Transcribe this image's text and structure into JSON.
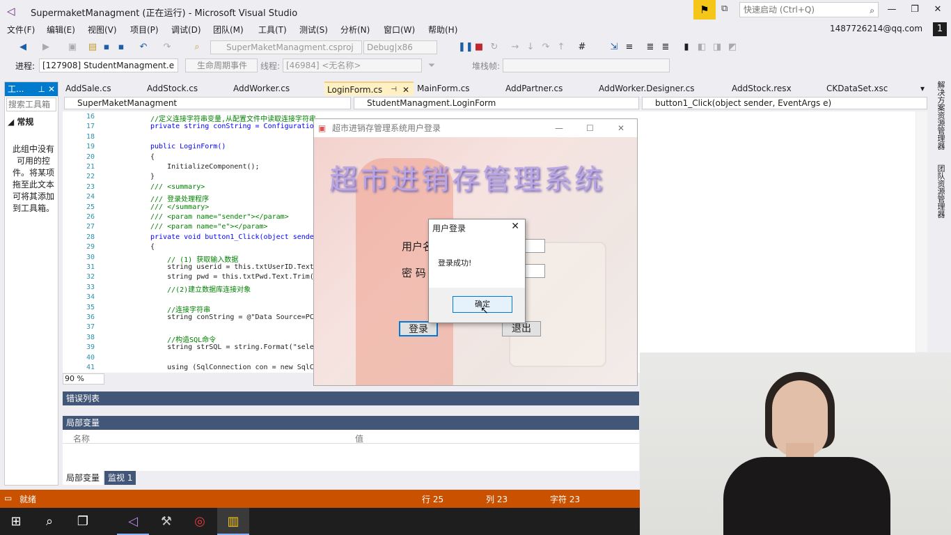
{
  "window": {
    "title": "SupermaketManagment (正在运行) - Microsoft Visual Studio",
    "quick_launch_placeholder": "快速启动 (Ctrl+Q)",
    "account": "1487726214@qq.com",
    "account_badge": "1"
  },
  "menu": [
    "文件(F)",
    "编辑(E)",
    "视图(V)",
    "项目(P)",
    "调试(D)",
    "团队(M)",
    "工具(T)",
    "测试(S)",
    "分析(N)",
    "窗口(W)",
    "帮助(H)"
  ],
  "toolbar": {
    "project_dropdown": "SuperMaketManagment.csproj",
    "config_dropdown": "Debug|x86",
    "process_label": "进程:",
    "process_value": "[127908] StudentManagment.e",
    "lifecycle_label": "生命周期事件",
    "thread_label": "线程:",
    "thread_value": "[46984] <无名称>",
    "stackframe_label": "堆栈帧:"
  },
  "toolbox": {
    "title": "工...",
    "search_placeholder": "搜索工具箱",
    "group": "常规",
    "empty_text": "此组中没有可用的控件。将某项拖至此文本可将其添加到工具箱。"
  },
  "tabs": [
    "AddSale.cs",
    "AddStock.cs",
    "AddWorker.cs",
    "LoginForm.cs",
    "MainForm.cs",
    "AddPartner.cs",
    "AddWorker.Designer.cs",
    "AddStock.resx",
    "CKDataSet.xsc"
  ],
  "active_tab": "LoginForm.cs",
  "navbar": {
    "project": "SuperMaketManagment",
    "class": "StudentManagment.LoginForm",
    "member": "button1_Click(object sender, EventArgs e)"
  },
  "code_lines": [
    {
      "n": "16",
      "t": "//定义连接字符串变量,从配置文件中读取连接字符串",
      "c": "comment"
    },
    {
      "n": "17",
      "t": "private string conString = Configuration",
      "c": "kw"
    },
    {
      "n": "18",
      "t": "",
      "c": ""
    },
    {
      "n": "19",
      "t": "public LoginForm()",
      "c": "kw"
    },
    {
      "n": "20",
      "t": "{",
      "c": ""
    },
    {
      "n": "21",
      "t": "    InitializeComponent();",
      "c": ""
    },
    {
      "n": "22",
      "t": "}",
      "c": ""
    },
    {
      "n": "23",
      "t": "/// <summary>",
      "c": "comment"
    },
    {
      "n": "24",
      "t": "/// 登录处理程序",
      "c": "comment"
    },
    {
      "n": "25",
      "t": "/// </summary>",
      "c": "comment"
    },
    {
      "n": "26",
      "t": "/// <param name=\"sender\"></param>",
      "c": "comment"
    },
    {
      "n": "27",
      "t": "/// <param name=\"e\"></param>",
      "c": "comment"
    },
    {
      "n": "28",
      "t": "private void button1_Click(object sender",
      "c": "kw"
    },
    {
      "n": "29",
      "t": "{",
      "c": ""
    },
    {
      "n": "30",
      "t": "    // (1) 获取输入数据",
      "c": "comment"
    },
    {
      "n": "31",
      "t": "    string userid = this.txtUserID.Text.",
      "c": ""
    },
    {
      "n": "32",
      "t": "    string pwd = this.txtPwd.Text.Trim()",
      "c": ""
    },
    {
      "n": "33",
      "t": "    //(2)建立数据库连接对象",
      "c": "comment"
    },
    {
      "n": "34",
      "t": "",
      "c": ""
    },
    {
      "n": "35",
      "t": "    //连接字符串",
      "c": "comment"
    },
    {
      "n": "36",
      "t": "    string conString = @\"Data Source=PC-",
      "c": ""
    },
    {
      "n": "37",
      "t": "",
      "c": ""
    },
    {
      "n": "38",
      "t": "    //构造SQL命令",
      "c": "comment"
    },
    {
      "n": "39",
      "t": "    string strSQL = string.Format(\"selec",
      "c": ""
    },
    {
      "n": "40",
      "t": "",
      "c": ""
    },
    {
      "n": "41",
      "t": "    using (SqlConnection con = new SqlCo",
      "c": ""
    }
  ],
  "zoom": "90 %",
  "right_strip": [
    "解决方案资源管理器",
    "团队资源管理器"
  ],
  "panels": {
    "error_list": "错误列表",
    "locals": "局部变量",
    "col_name": "名称",
    "col_value": "值",
    "bottom_tabs": [
      "局部变量",
      "监视 1"
    ]
  },
  "status": {
    "ready": "就绪",
    "line": "行 25",
    "col": "列 23",
    "char": "字符 23"
  },
  "login_form": {
    "title": "超市进销存管理系统用户登录",
    "system_title": "超市进销存管理系统",
    "user_label": "用户名",
    "pwd_label": "密  码",
    "login_button": "登录",
    "exit_button": "退出"
  },
  "message_box": {
    "title": "用户登录",
    "text": "登录成功!",
    "ok_button": "确定"
  },
  "colors": {
    "accent": "#007acc",
    "statusbar": "#ca5100",
    "panel_header": "#425677"
  }
}
